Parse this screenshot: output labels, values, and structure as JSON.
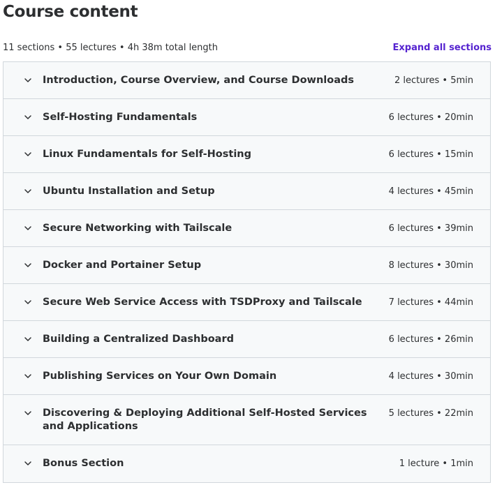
{
  "header": {
    "title": "Course content",
    "summary": "11 sections • 55 lectures • 4h 38m total length",
    "expand_all": "Expand all sections"
  },
  "colors": {
    "accent": "#5624d0",
    "section_bg": "#f7f9fa",
    "border": "#d1d7dc",
    "text": "#2d2f31"
  },
  "sections": [
    {
      "title": "Introduction, Course Overview, and Course Downloads",
      "meta": "2 lectures • 5min",
      "icon": "chevron-down-icon"
    },
    {
      "title": "Self-Hosting Fundamentals",
      "meta": "6 lectures • 20min",
      "icon": "chevron-down-icon"
    },
    {
      "title": "Linux Fundamentals for Self-Hosting",
      "meta": "6 lectures • 15min",
      "icon": "chevron-down-icon"
    },
    {
      "title": "Ubuntu Installation and Setup",
      "meta": "4 lectures • 45min",
      "icon": "chevron-down-icon"
    },
    {
      "title": "Secure Networking with Tailscale",
      "meta": "6 lectures • 39min",
      "icon": "chevron-down-icon"
    },
    {
      "title": "Docker and Portainer Setup",
      "meta": "8 lectures • 30min",
      "icon": "chevron-down-icon"
    },
    {
      "title": "Secure Web Service Access with TSDProxy and Tailscale",
      "meta": "7 lectures • 44min",
      "icon": "chevron-down-icon"
    },
    {
      "title": "Building a Centralized Dashboard",
      "meta": "6 lectures • 26min",
      "icon": "chevron-down-icon"
    },
    {
      "title": "Publishing Services on Your Own Domain",
      "meta": "4 lectures • 30min",
      "icon": "chevron-down-icon"
    },
    {
      "title": "Discovering & Deploying Additional Self-Hosted Services and Applications",
      "meta": "5 lectures • 22min",
      "icon": "chevron-down-icon"
    },
    {
      "title": "Bonus Section",
      "meta": "1 lecture • 1min",
      "icon": "chevron-down-icon"
    }
  ]
}
